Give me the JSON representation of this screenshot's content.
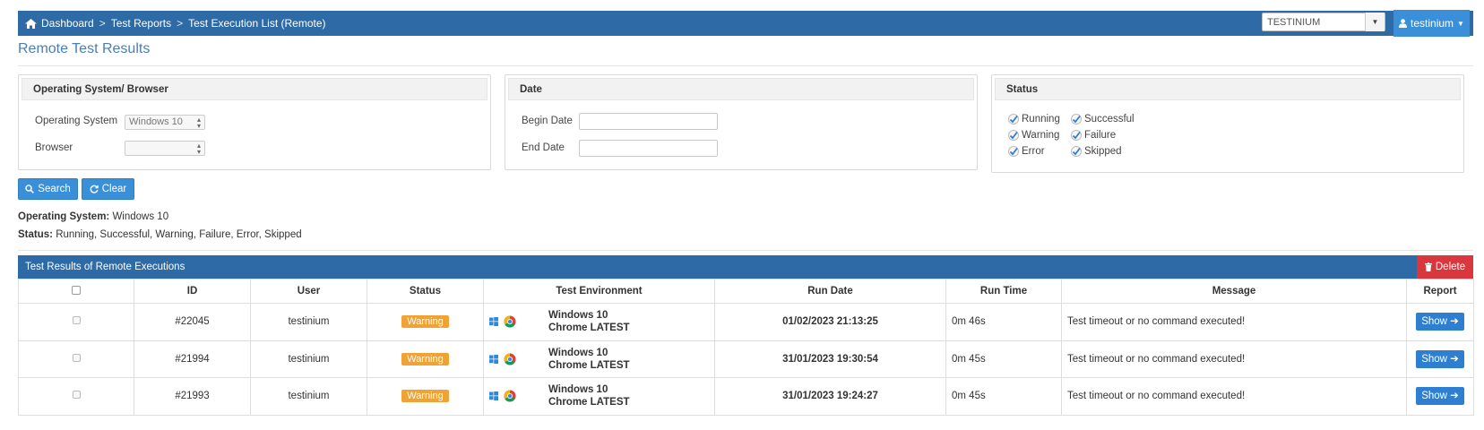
{
  "breadcrumb": {
    "items": [
      "Dashboard",
      "Test Reports",
      "Test Execution List (Remote)"
    ],
    "separator": ">"
  },
  "header": {
    "project_select_value": "TESTINIUM",
    "user_name": "testinium"
  },
  "page_title": "Remote Test Results",
  "filters": {
    "os_browser": {
      "title": "Operating System/ Browser",
      "os_label": "Operating System",
      "os_value": "Windows 10",
      "browser_label": "Browser",
      "browser_value": ""
    },
    "date": {
      "title": "Date",
      "begin_label": "Begin Date",
      "end_label": "End Date",
      "begin_value": "",
      "end_value": ""
    },
    "status": {
      "title": "Status",
      "options": [
        "Running",
        "Successful",
        "Warning",
        "Failure",
        "Error",
        "Skipped"
      ]
    }
  },
  "actions": {
    "search_label": "Search",
    "clear_label": "Clear",
    "delete_label": "Delete"
  },
  "summary": {
    "os_label": "Operating System:",
    "os_value": "Windows 10",
    "status_label": "Status:",
    "status_value": "Running, Successful, Warning, Failure, Error, Skipped"
  },
  "results": {
    "title": "Test Results of Remote Executions",
    "columns": [
      "",
      "ID",
      "User",
      "Status",
      "Test Environment",
      "Run Date",
      "Run Time",
      "Message",
      "Report"
    ],
    "rows": [
      {
        "id": "#22045",
        "user": "testinium",
        "status": "Warning",
        "env_os": "Windows 10",
        "env_browser": "Chrome LATEST",
        "run_date": "01/02/2023 21:13:25",
        "run_time": "0m 46s",
        "message": "Test timeout or no command executed!",
        "report": "Show"
      },
      {
        "id": "#21994",
        "user": "testinium",
        "status": "Warning",
        "env_os": "Windows 10",
        "env_browser": "Chrome LATEST",
        "run_date": "31/01/2023 19:30:54",
        "run_time": "0m 45s",
        "message": "Test timeout or no command executed!",
        "report": "Show"
      },
      {
        "id": "#21993",
        "user": "testinium",
        "status": "Warning",
        "env_os": "Windows 10",
        "env_browser": "Chrome LATEST",
        "run_date": "31/01/2023 19:24:27",
        "run_time": "0m 45s",
        "message": "Test timeout or no command executed!",
        "report": "Show"
      }
    ]
  },
  "colors": {
    "header_blue": "#2e6aa5",
    "button_blue": "#3a8fd9",
    "warning_orange": "#f0a235",
    "delete_red": "#d9363e"
  }
}
